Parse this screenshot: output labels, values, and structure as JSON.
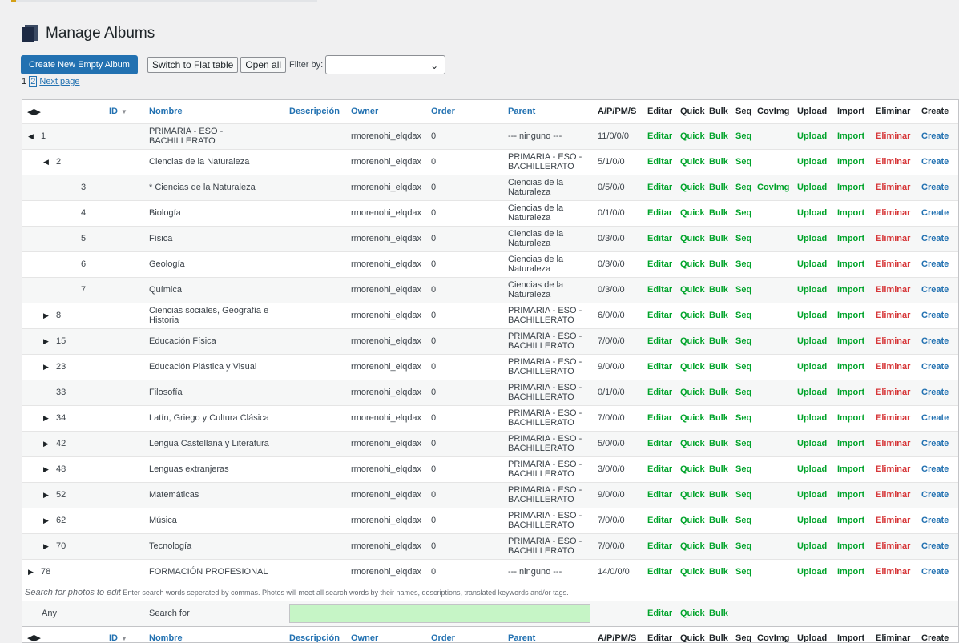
{
  "page": {
    "title": "Manage Albums"
  },
  "toolbar": {
    "create_label": "Create New Empty Album",
    "flat_label": "Switch to Flat table",
    "open_all_label": "Open all",
    "filter_label": "Filter by:",
    "filter_value": ""
  },
  "pager": {
    "page1": "1",
    "page2": "2",
    "next": "Next page"
  },
  "columns": {
    "id": "ID",
    "name": "Nombre",
    "desc": "Descripción",
    "owner": "Owner",
    "order": "Order",
    "parent": "Parent",
    "apm": "A/P/PM/S",
    "edit": "Editar",
    "quick": "Quick",
    "bulk": "Bulk",
    "seq": "Seq",
    "covimg": "CovImg",
    "upload": "Upload",
    "import": "Import",
    "delete": "Eliminar",
    "create": "Create"
  },
  "rows": [
    {
      "id": "1",
      "name": "PRIMARIA - ESO - BACHILLERATO",
      "owner": "rmorenohi_elqdax",
      "order": "0",
      "parent": "--- ninguno ---",
      "apm": "11/0/0/0",
      "level": 0,
      "toggle": "open",
      "covimg": ""
    },
    {
      "id": "2",
      "name": "Ciencias de la Naturaleza",
      "owner": "rmorenohi_elqdax",
      "order": "0",
      "parent": "PRIMARIA - ESO - BACHILLERATO",
      "apm": "5/1/0/0",
      "level": 1,
      "toggle": "open",
      "covimg": ""
    },
    {
      "id": "3",
      "name": "* Ciencias de la Naturaleza",
      "owner": "rmorenohi_elqdax",
      "order": "0",
      "parent": "Ciencias de la Naturaleza",
      "apm": "0/5/0/0",
      "level": 2,
      "toggle": "",
      "covimg": "CovImg"
    },
    {
      "id": "4",
      "name": "Biología",
      "owner": "rmorenohi_elqdax",
      "order": "0",
      "parent": "Ciencias de la Naturaleza",
      "apm": "0/1/0/0",
      "level": 2,
      "toggle": "",
      "covimg": ""
    },
    {
      "id": "5",
      "name": "Física",
      "owner": "rmorenohi_elqdax",
      "order": "0",
      "parent": "Ciencias de la Naturaleza",
      "apm": "0/3/0/0",
      "level": 2,
      "toggle": "",
      "covimg": ""
    },
    {
      "id": "6",
      "name": "Geología",
      "owner": "rmorenohi_elqdax",
      "order": "0",
      "parent": "Ciencias de la Naturaleza",
      "apm": "0/3/0/0",
      "level": 2,
      "toggle": "",
      "covimg": ""
    },
    {
      "id": "7",
      "name": "Química",
      "owner": "rmorenohi_elqdax",
      "order": "0",
      "parent": "Ciencias de la Naturaleza",
      "apm": "0/3/0/0",
      "level": 2,
      "toggle": "",
      "covimg": ""
    },
    {
      "id": "8",
      "name": "Ciencias sociales, Geografía e Historia",
      "owner": "rmorenohi_elqdax",
      "order": "0",
      "parent": "PRIMARIA - ESO - BACHILLERATO",
      "apm": "6/0/0/0",
      "level": 1,
      "toggle": "closed",
      "covimg": ""
    },
    {
      "id": "15",
      "name": "Educación Física",
      "owner": "rmorenohi_elqdax",
      "order": "0",
      "parent": "PRIMARIA - ESO - BACHILLERATO",
      "apm": "7/0/0/0",
      "level": 1,
      "toggle": "closed",
      "covimg": ""
    },
    {
      "id": "23",
      "name": "Educación Plástica y Visual",
      "owner": "rmorenohi_elqdax",
      "order": "0",
      "parent": "PRIMARIA - ESO - BACHILLERATO",
      "apm": "9/0/0/0",
      "level": 1,
      "toggle": "closed",
      "covimg": ""
    },
    {
      "id": "33",
      "name": "Filosofía",
      "owner": "rmorenohi_elqdax",
      "order": "0",
      "parent": "PRIMARIA - ESO - BACHILLERATO",
      "apm": "0/1/0/0",
      "level": 1,
      "toggle": "",
      "covimg": ""
    },
    {
      "id": "34",
      "name": "Latín, Griego y Cultura Clásica",
      "owner": "rmorenohi_elqdax",
      "order": "0",
      "parent": "PRIMARIA - ESO - BACHILLERATO",
      "apm": "7/0/0/0",
      "level": 1,
      "toggle": "closed",
      "covimg": ""
    },
    {
      "id": "42",
      "name": "Lengua Castellana y Literatura",
      "owner": "rmorenohi_elqdax",
      "order": "0",
      "parent": "PRIMARIA - ESO - BACHILLERATO",
      "apm": "5/0/0/0",
      "level": 1,
      "toggle": "closed",
      "covimg": ""
    },
    {
      "id": "48",
      "name": "Lenguas extranjeras",
      "owner": "rmorenohi_elqdax",
      "order": "0",
      "parent": "PRIMARIA - ESO - BACHILLERATO",
      "apm": "3/0/0/0",
      "level": 1,
      "toggle": "closed",
      "covimg": ""
    },
    {
      "id": "52",
      "name": "Matemáticas",
      "owner": "rmorenohi_elqdax",
      "order": "0",
      "parent": "PRIMARIA - ESO - BACHILLERATO",
      "apm": "9/0/0/0",
      "level": 1,
      "toggle": "closed",
      "covimg": ""
    },
    {
      "id": "62",
      "name": "Música",
      "owner": "rmorenohi_elqdax",
      "order": "0",
      "parent": "PRIMARIA - ESO - BACHILLERATO",
      "apm": "7/0/0/0",
      "level": 1,
      "toggle": "closed",
      "covimg": ""
    },
    {
      "id": "70",
      "name": "Tecnología",
      "owner": "rmorenohi_elqdax",
      "order": "0",
      "parent": "PRIMARIA - ESO - BACHILLERATO",
      "apm": "7/0/0/0",
      "level": 1,
      "toggle": "closed",
      "covimg": ""
    },
    {
      "id": "78",
      "name": "FORMACIÓN PROFESIONAL",
      "owner": "rmorenohi_elqdax",
      "order": "0",
      "parent": "--- ninguno ---",
      "apm": "14/0/0/0",
      "level": 0,
      "toggle": "closed",
      "covimg": ""
    }
  ],
  "search": {
    "heading": "Search for photos to edit",
    "hint": "Enter search words seperated by commas. Photos will meet all search words by their names, descriptions, translated keywords and/or tags.",
    "any": "Any",
    "search_for": "Search for",
    "value": ""
  },
  "colors": {
    "primary": "#2271b1",
    "action_green": "#00a32a",
    "delete_red": "#d63638",
    "search_bg": "#c6f5c6"
  }
}
